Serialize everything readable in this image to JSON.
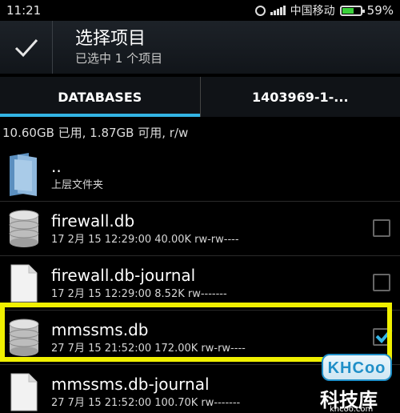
{
  "status_bar": {
    "time": "11:21",
    "carrier": "中国移动",
    "battery": "59%",
    "battery_level": 0.59
  },
  "action_bar": {
    "check_icon": "check-icon",
    "title": "选择项目",
    "subtitle": "已选中 1 个项目"
  },
  "tabs": [
    {
      "label": "DATABASES",
      "active": true
    },
    {
      "label": "1403969-1-...",
      "active": false
    }
  ],
  "storage_info": "10.60GB 已用, 1.87GB 可用, r/w",
  "files": [
    {
      "name": "..",
      "meta": "上层文件夹",
      "icon": "folder-icon",
      "checkbox": false,
      "checked": false
    },
    {
      "name": "firewall.db",
      "meta": "17 2月 15 12:29:00  40.00K  rw-rw----",
      "icon": "database-icon",
      "checkbox": true,
      "checked": false
    },
    {
      "name": "firewall.db-journal",
      "meta": "17 2月 15 12:29:00  8.52K  rw-------",
      "icon": "file-icon",
      "checkbox": true,
      "checked": false
    },
    {
      "name": "mmssms.db",
      "meta": "27 7月 15 21:52:00  172.00K  rw-rw----",
      "icon": "database-icon",
      "checkbox": true,
      "checked": true
    },
    {
      "name": "mmssms.db-journal",
      "meta": "27 7月 15 21:52:00  100.70K  rw-------",
      "icon": "file-icon",
      "checkbox": false,
      "checked": false
    }
  ],
  "watermark": {
    "logo": "KHCoo",
    "title": "科技库",
    "url": "khcoo.com"
  },
  "colors": {
    "accent": "#33b5e5",
    "highlight": "#f0f000",
    "battery": "#3ad03a"
  }
}
